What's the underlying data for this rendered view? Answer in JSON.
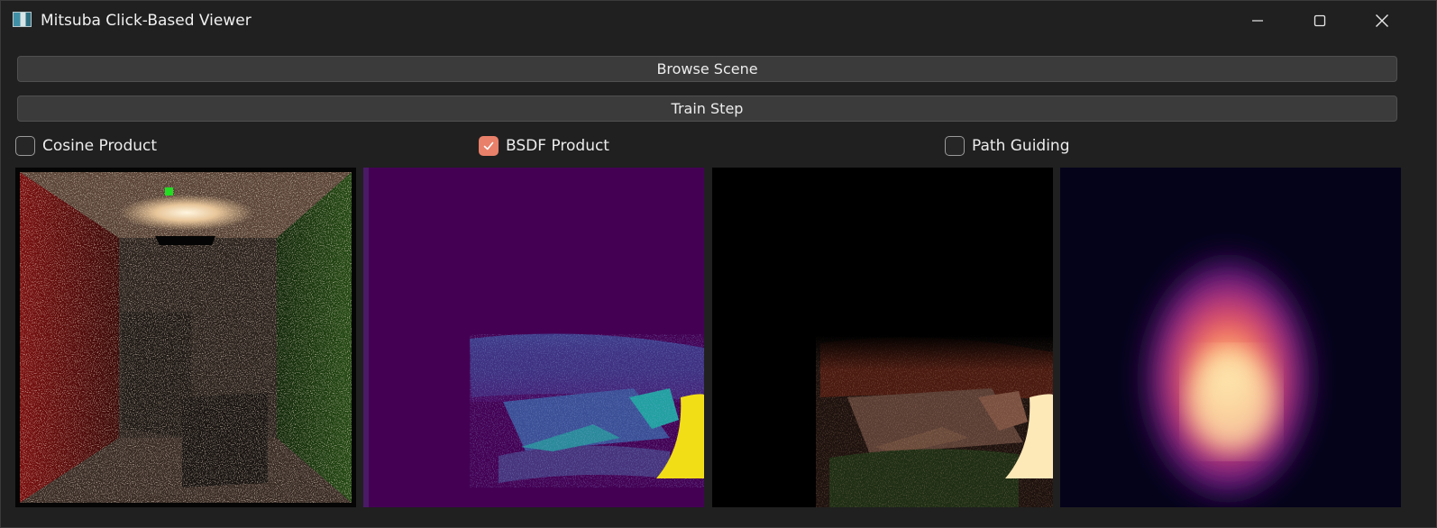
{
  "window": {
    "title": "Mitsuba Click-Based Viewer",
    "icon": "app-window-icon",
    "controls": [
      "minimize-icon",
      "maximize-icon",
      "close-icon"
    ]
  },
  "buttons": {
    "browse_label": "Browse Scene",
    "train_label": "Train Step"
  },
  "options": {
    "cosine": {
      "label": "Cosine Product",
      "checked": false
    },
    "bsdf": {
      "label": "BSDF Product",
      "checked": true
    },
    "path": {
      "label": "Path Guiding",
      "checked": false
    }
  },
  "colors": {
    "accent": "#e9806a",
    "background": "#202020",
    "button": "#3b3b3b",
    "selected_pixel_marker": "#22dd22"
  },
  "views": [
    {
      "name": "rendered-scene",
      "description": "Cornell box render with red left wall, green right wall and two boxes"
    },
    {
      "name": "bsdf-product-visualization",
      "description": "viridis-style false-color map"
    },
    {
      "name": "incident-radiance-visualization",
      "description": "dark radiance image"
    },
    {
      "name": "guiding-distribution-heatmap",
      "description": "magma-style heatmap"
    }
  ]
}
